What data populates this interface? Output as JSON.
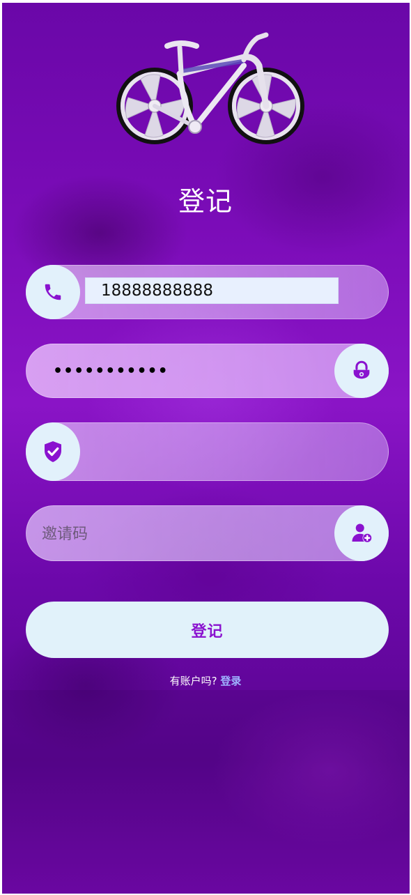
{
  "colors": {
    "accent": "#8a12cf",
    "icon_bg": "#e2f1fb",
    "button_bg": "#e1f2fa",
    "link": "#9fb3ff"
  },
  "header": {
    "title": "登记",
    "logo": "bicycle-image"
  },
  "form": {
    "phone": {
      "icon": "phone-icon",
      "value": "18888888888"
    },
    "password": {
      "icon": "lock-icon",
      "masked_value": "•••••••••••"
    },
    "captcha": {
      "icon": "shield-check-icon",
      "value": ""
    },
    "invite": {
      "icon": "add-user-icon",
      "placeholder": "邀请码",
      "value": ""
    }
  },
  "submit_label": "登记",
  "footer": {
    "prompt": "有账户吗?",
    "login_label": "登录"
  }
}
